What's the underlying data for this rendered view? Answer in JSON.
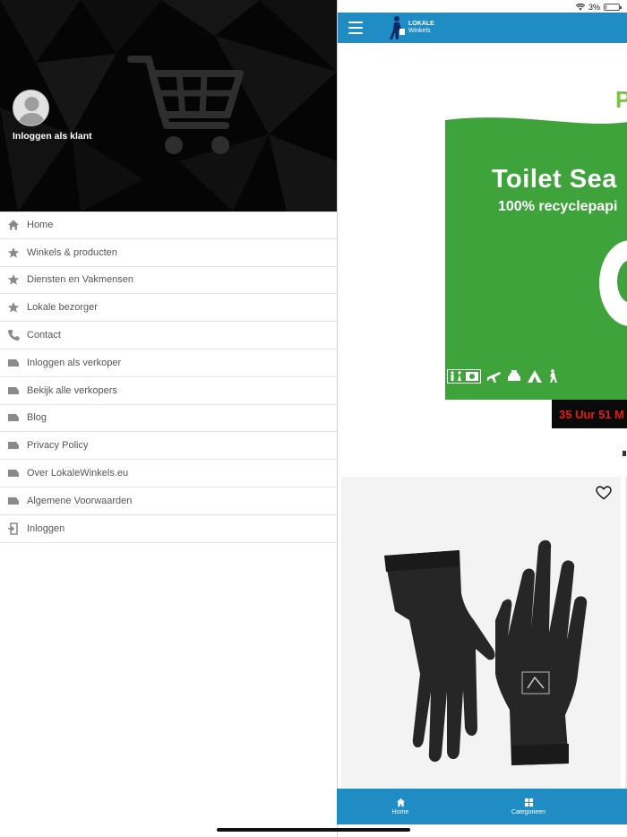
{
  "status_bar": {
    "battery_text": "3%",
    "battery_level": 0.05
  },
  "colors": {
    "appbar": "#1f8dc4",
    "banner_green": "#3ea33b",
    "countdown_red": "#e31b1b",
    "drawer_header": "#050505"
  },
  "drawer": {
    "login_klant": "Inloggen als klant",
    "menu": [
      {
        "label": "Home",
        "icon": "home-icon"
      },
      {
        "label": "Winkels & producten",
        "icon": "star-icon"
      },
      {
        "label": "Diensten en Vakmensen",
        "icon": "star-icon"
      },
      {
        "label": "Lokale bezorger",
        "icon": "star-icon"
      },
      {
        "label": "Contact",
        "icon": "phone-icon"
      },
      {
        "label": "Inloggen als verkoper",
        "icon": "label-icon"
      },
      {
        "label": "Bekijk alle verkopers",
        "icon": "label-icon"
      },
      {
        "label": "Blog",
        "icon": "label-icon"
      },
      {
        "label": "Privacy Policy",
        "icon": "label-icon"
      },
      {
        "label": "Over LokaleWinkels.eu",
        "icon": "label-icon"
      },
      {
        "label": "Algemene Voorwaarden",
        "icon": "label-icon"
      },
      {
        "label": "Inloggen",
        "icon": "login-icon"
      }
    ]
  },
  "app": {
    "logo": {
      "line1": "LOKALE",
      "line2": "Winkels"
    },
    "partial_letters": "PA",
    "banner": {
      "title": "Toilet Sea",
      "subtitle": "100% recyclepapi"
    },
    "countdown": "35 Uur 51 M",
    "bottom_nav": [
      {
        "label": "Home",
        "icon": "home-icon"
      },
      {
        "label": "Categorieen",
        "icon": "grid-icon"
      }
    ]
  }
}
